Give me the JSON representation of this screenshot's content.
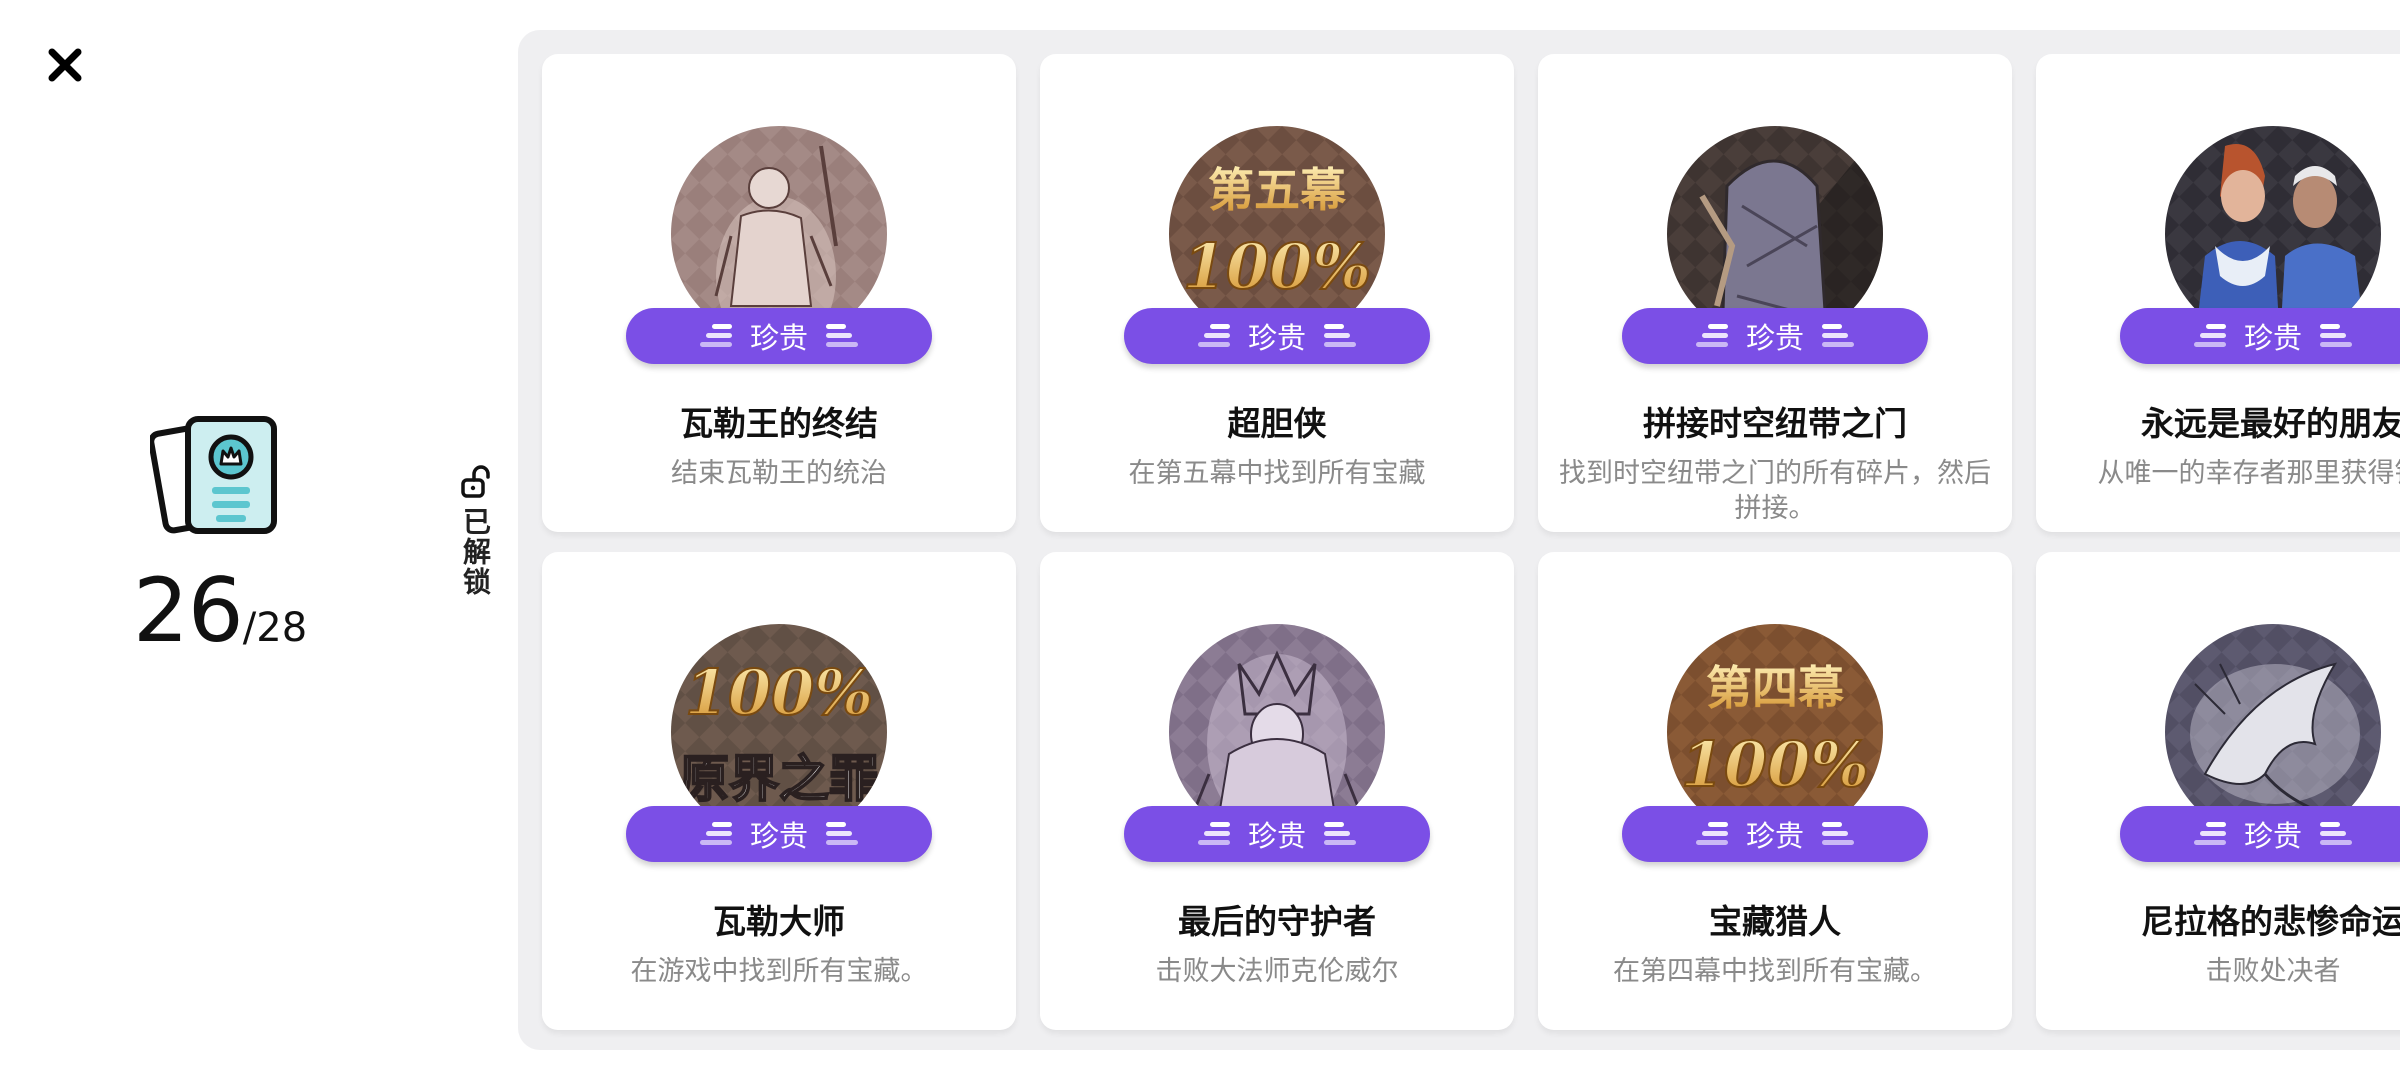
{
  "summary": {
    "unlocked": "26",
    "total": "/28",
    "filter_label": "已解锁"
  },
  "icons": {
    "close": "close-icon",
    "summary": "achievement-cards-icon",
    "filter": "unlock-icon"
  },
  "colors": {
    "badge": "#7b4fe6",
    "panel": "#efeff1",
    "desc_text": "#8a8a8a"
  },
  "achievements": [
    {
      "title": "瓦勒王的终结",
      "description": "结束瓦勒王的统治",
      "rarity": "珍贵",
      "medal_text_1": "",
      "medal_text_2": ""
    },
    {
      "title": "超胆侠",
      "description": "在第五幕中找到所有宝藏",
      "rarity": "珍贵",
      "medal_text_1": "第五幕",
      "medal_text_2": "100%"
    },
    {
      "title": "拼接时空纽带之门",
      "description": "找到时空纽带之门的所有碎片，然后拼接。",
      "rarity": "珍贵",
      "medal_text_1": "",
      "medal_text_2": ""
    },
    {
      "title": "永远是最好的朋友",
      "description": "从唯一的幸存者那里获得钥匙",
      "rarity": "珍贵",
      "medal_text_1": "",
      "medal_text_2": ""
    },
    {
      "title": "瓦勒大师",
      "description": "在游戏中找到所有宝藏。",
      "rarity": "珍贵",
      "medal_text_1": "100%",
      "medal_text_2": "原界之罪"
    },
    {
      "title": "最后的守护者",
      "description": "击败大法师克伦威尔",
      "rarity": "珍贵",
      "medal_text_1": "",
      "medal_text_2": ""
    },
    {
      "title": "宝藏猎人",
      "description": "在第四幕中找到所有宝藏。",
      "rarity": "珍贵",
      "medal_text_1": "第四幕",
      "medal_text_2": "100%"
    },
    {
      "title": "尼拉格的悲惨命运",
      "description": "击败处决者",
      "rarity": "珍贵",
      "medal_text_1": "",
      "medal_text_2": ""
    }
  ]
}
